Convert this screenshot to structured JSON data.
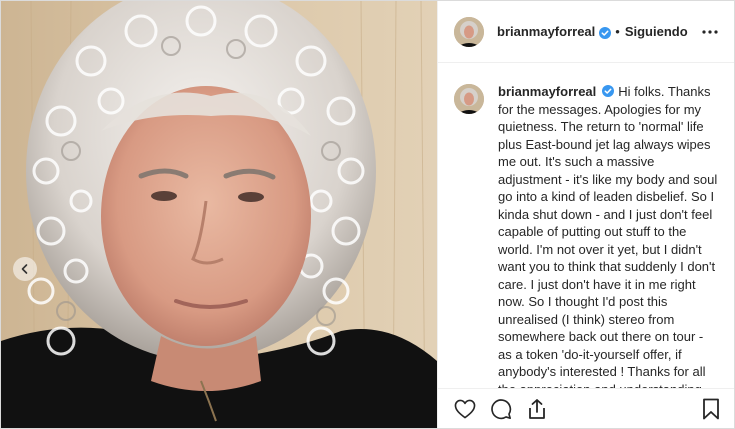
{
  "post": {
    "username": "brianmayforreal",
    "separator": "•",
    "follow_status": "Siguiendo",
    "more_icon": "more-options-icon",
    "caption": {
      "username": "brianmayforreal",
      "text": "Hi folks. Thanks for the messages. Apologies for my quietness. The return to 'normal' life plus East-bound jet lag always wipes me out. It's such a massive adjustment - it's like my body and soul go into a kind of leaden disbelief. So I kinda shut down - and I just don't feel capable of putting out stuff to the world. I'm not over it yet, but I didn't want you to think that suddenly I don't care. I just don't have it in me right now. So I thought I'd post this unrealised (I think) stereo from somewhere back out there on tour - as a token 'do-it-yourself offer, if anybody's interested ! Thanks for all the appreciation and understanding you gave us - and me - during that"
    },
    "actions": [
      "heart-icon",
      "comment-icon",
      "share-icon",
      "bookmark-icon"
    ],
    "colors": {
      "verified": "#3897f0",
      "text": "#262626",
      "border": "#efefef"
    }
  }
}
